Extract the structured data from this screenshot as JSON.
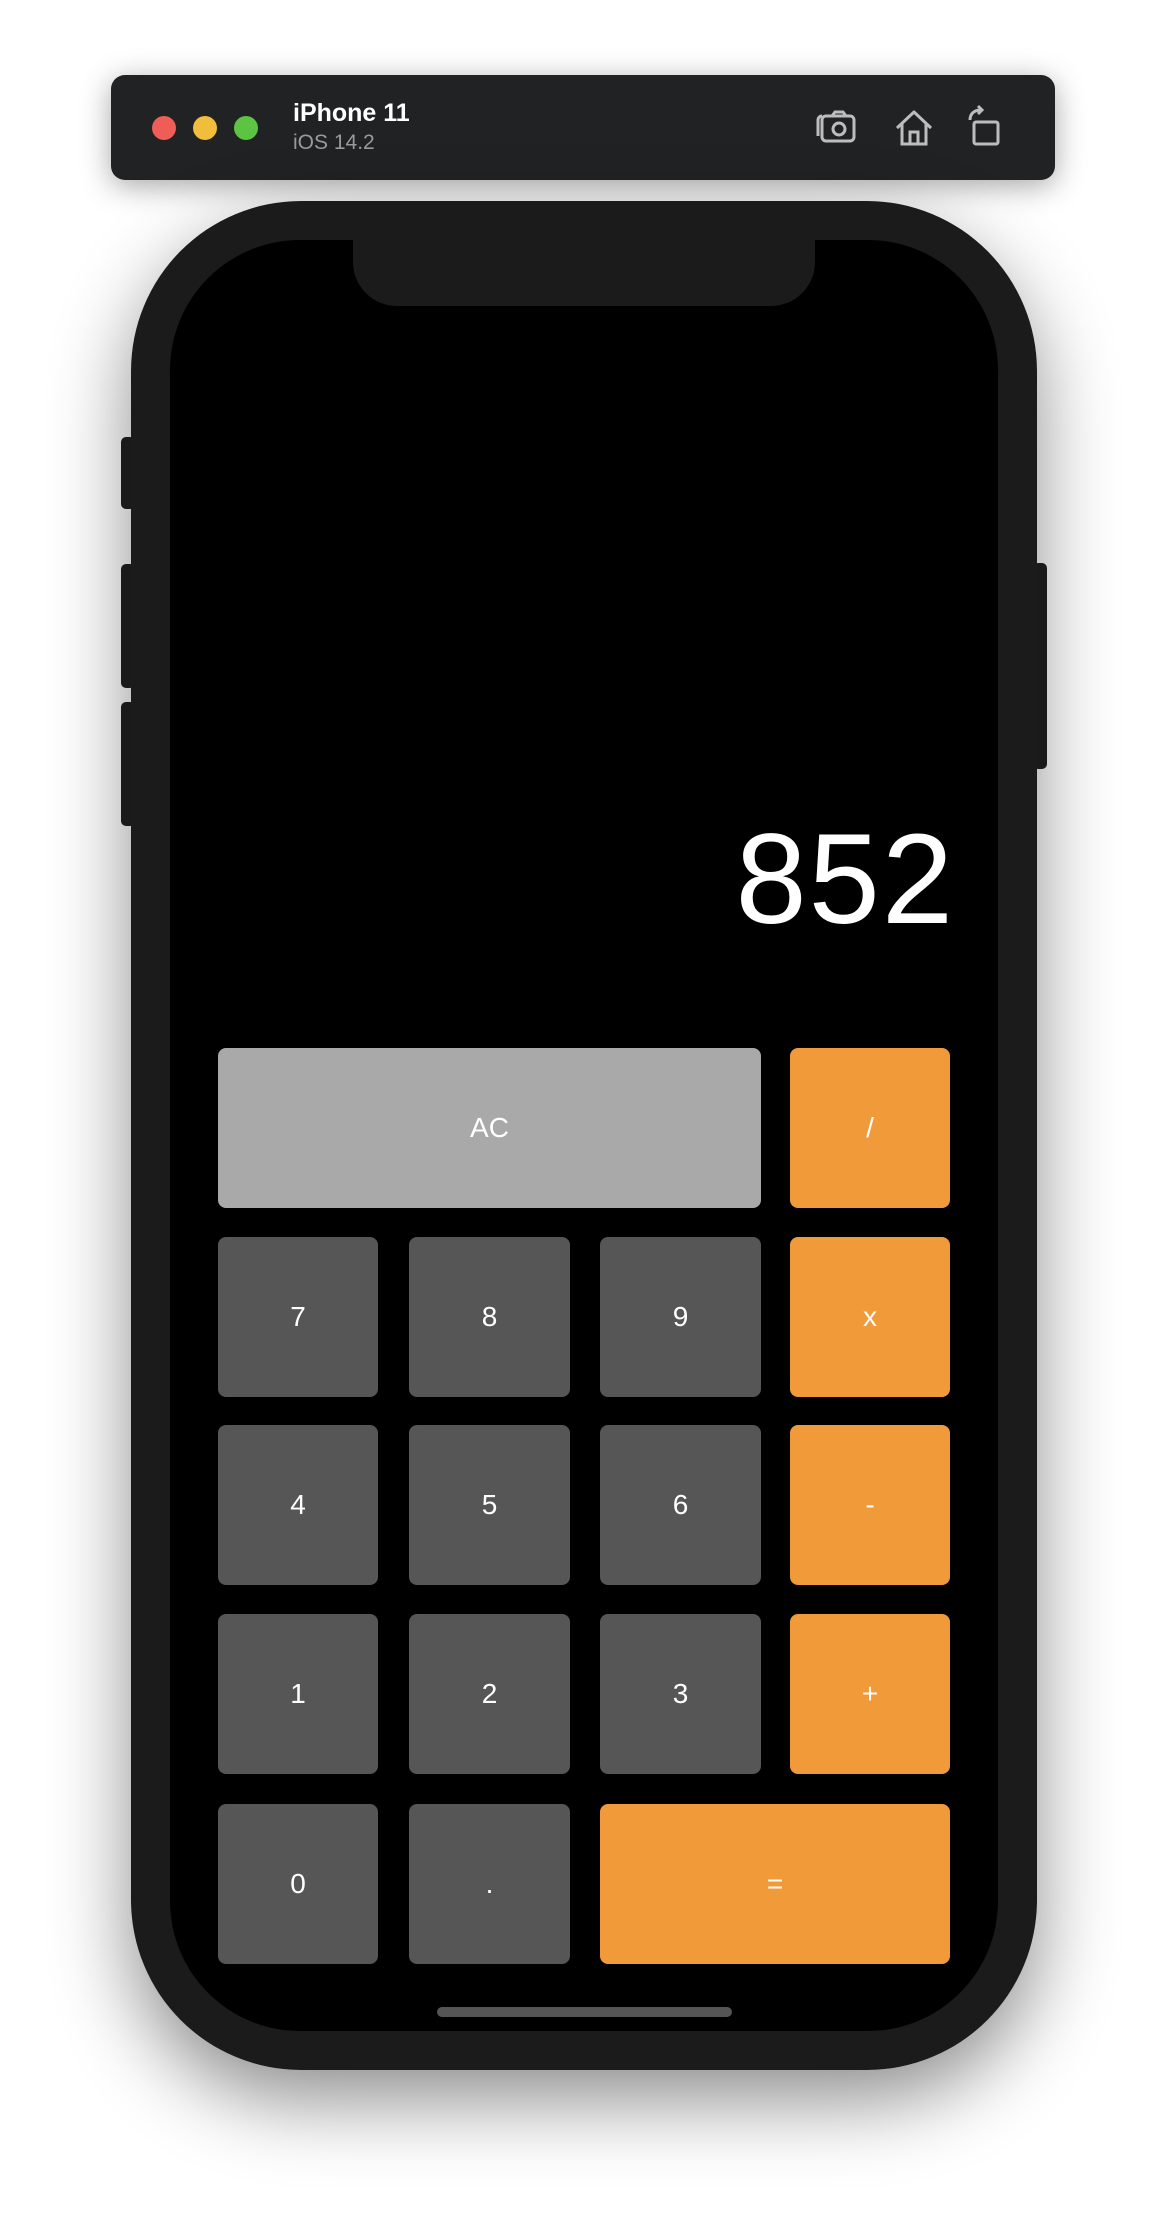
{
  "simulator": {
    "device_name": "iPhone 11",
    "os_version": "iOS 14.2",
    "icons": [
      "close-icon",
      "minimize-icon",
      "maximize-icon",
      "screenshot-icon",
      "home-icon",
      "rotate-icon"
    ]
  },
  "calculator": {
    "display_value": "852",
    "keys": {
      "clear": "AC",
      "divide": "/",
      "multiply": "x",
      "subtract": "-",
      "add": "+",
      "equals": "=",
      "decimal": ".",
      "d0": "0",
      "d1": "1",
      "d2": "2",
      "d3": "3",
      "d4": "4",
      "d5": "5",
      "d6": "6",
      "d7": "7",
      "d8": "8",
      "d9": "9"
    }
  },
  "colors": {
    "operator": "#f09a3a",
    "digit": "#565656",
    "function": "#a9a9a9",
    "screen": "#000000"
  }
}
